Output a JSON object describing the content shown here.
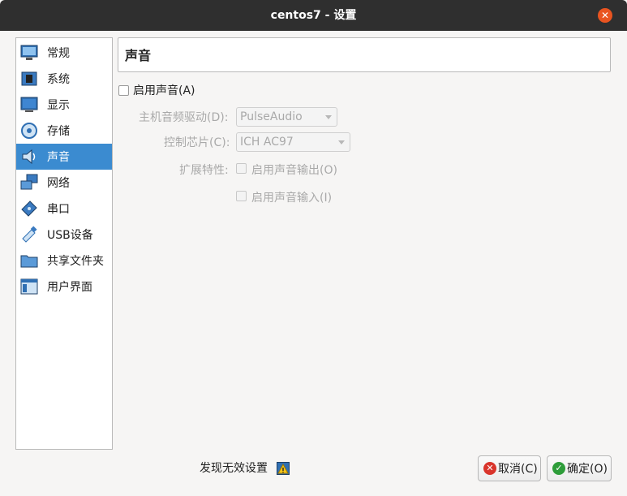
{
  "window": {
    "title": "centos7 - 设置",
    "close_icon": "close-icon"
  },
  "sidebar": {
    "items": [
      {
        "label": "常规",
        "icon": "general-monitor-icon"
      },
      {
        "label": "系统",
        "icon": "system-chip-icon"
      },
      {
        "label": "显示",
        "icon": "display-monitor-icon"
      },
      {
        "label": "存储",
        "icon": "storage-disk-icon"
      },
      {
        "label": "声音",
        "icon": "speaker-icon",
        "selected": true
      },
      {
        "label": "网络",
        "icon": "network-icon"
      },
      {
        "label": "串口",
        "icon": "serial-port-icon"
      },
      {
        "label": "USB设备",
        "icon": "usb-icon"
      },
      {
        "label": "共享文件夹",
        "icon": "folder-icon"
      },
      {
        "label": "用户界面",
        "icon": "user-interface-icon"
      }
    ]
  },
  "audio": {
    "page_title": "声音",
    "enable_audio": {
      "label": "启用声音(A)",
      "checked": false
    },
    "host_driver": {
      "label": "主机音频驱动(D):",
      "value": "PulseAudio"
    },
    "controller": {
      "label": "控制芯片(C):",
      "value": "ICH AC97"
    },
    "extended": {
      "label": "扩展特性:",
      "enable_output": {
        "label": "启用声音输出(O)",
        "checked": false
      },
      "enable_input": {
        "label": "启用声音输入(I)",
        "checked": false
      }
    }
  },
  "footer": {
    "invalid_settings_label": "发现无效设置",
    "warning_icon": "warning-icon",
    "cancel_label": "取消(C)",
    "ok_label": "确定(O)"
  },
  "colors": {
    "accent": "#3b8bd0",
    "titlebar": "#2f2f2f",
    "close": "#e95420"
  }
}
